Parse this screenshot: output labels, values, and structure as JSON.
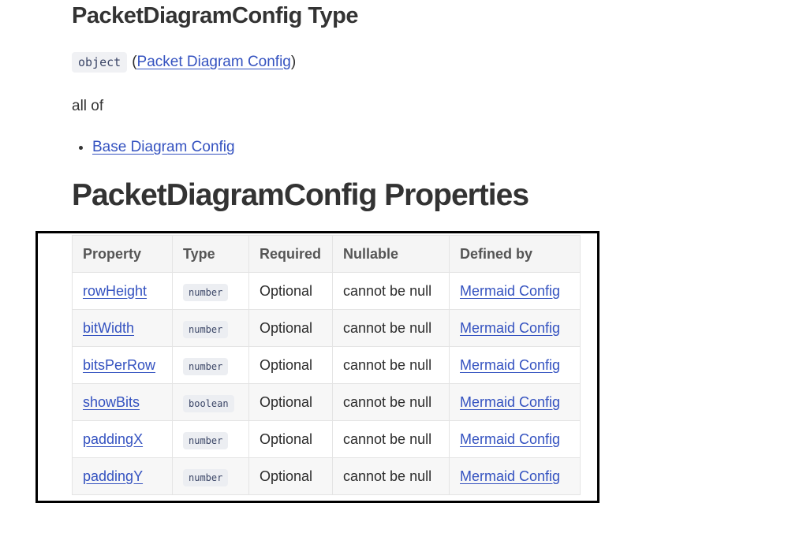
{
  "type_section": {
    "title": "PacketDiagramConfig Type",
    "type_code": "object",
    "paren_open": "(",
    "type_link": "Packet Diagram Config",
    "paren_close": ")",
    "all_of_label": "all of",
    "all_of_items": [
      "Base Diagram Config"
    ]
  },
  "properties_section": {
    "title": "PacketDiagramConfig Properties",
    "headers": [
      "Property",
      "Type",
      "Required",
      "Nullable",
      "Defined by"
    ],
    "rows": [
      {
        "property": "rowHeight",
        "type": "number",
        "required": "Optional",
        "nullable": "cannot be null",
        "defined_by": "Mermaid Config"
      },
      {
        "property": "bitWidth",
        "type": "number",
        "required": "Optional",
        "nullable": "cannot be null",
        "defined_by": "Mermaid Config"
      },
      {
        "property": "bitsPerRow",
        "type": "number",
        "required": "Optional",
        "nullable": "cannot be null",
        "defined_by": "Mermaid Config"
      },
      {
        "property": "showBits",
        "type": "boolean",
        "required": "Optional",
        "nullable": "cannot be null",
        "defined_by": "Mermaid Config"
      },
      {
        "property": "paddingX",
        "type": "number",
        "required": "Optional",
        "nullable": "cannot be null",
        "defined_by": "Mermaid Config"
      },
      {
        "property": "paddingY",
        "type": "number",
        "required": "Optional",
        "nullable": "cannot be null",
        "defined_by": "Mermaid Config"
      }
    ]
  },
  "colors": {
    "link": "#3452c0",
    "highlight_border": "#000000"
  }
}
